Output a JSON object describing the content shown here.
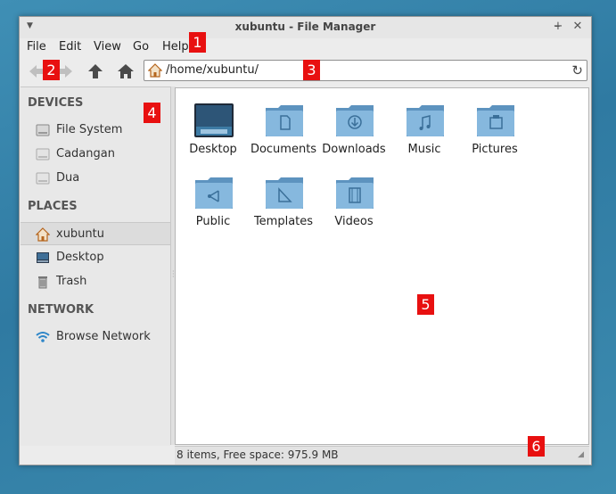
{
  "window": {
    "title": "xubuntu - File Manager",
    "controls": {
      "minimize": "–",
      "maximize": "+",
      "close": "✕"
    }
  },
  "menubar": [
    "File",
    "Edit",
    "View",
    "Go",
    "Help"
  ],
  "location": {
    "path": "/home/xubuntu/"
  },
  "sidebar": {
    "devices_heading": "DEVICES",
    "devices": [
      "File System",
      "Cadangan",
      "Dua"
    ],
    "places_heading": "PLACES",
    "places": [
      "xubuntu",
      "Desktop",
      "Trash"
    ],
    "network_heading": "NETWORK",
    "network": [
      "Browse Network"
    ],
    "selected": "xubuntu"
  },
  "files": [
    {
      "name": "Desktop",
      "icon": "desktop-folder-icon"
    },
    {
      "name": "Documents",
      "icon": "documents-folder-icon"
    },
    {
      "name": "Downloads",
      "icon": "downloads-folder-icon"
    },
    {
      "name": "Music",
      "icon": "music-folder-icon"
    },
    {
      "name": "Pictures",
      "icon": "pictures-folder-icon"
    },
    {
      "name": "Public",
      "icon": "public-folder-icon"
    },
    {
      "name": "Templates",
      "icon": "templates-folder-icon"
    },
    {
      "name": "Videos",
      "icon": "videos-folder-icon"
    }
  ],
  "status": {
    "text": "8 items, Free space: 975.9 MB"
  },
  "badges": [
    "1",
    "2",
    "3",
    "4",
    "5",
    "6"
  ],
  "colors": {
    "badge": "#e81010",
    "folder": "#7fb2d9",
    "desktop_bg": "#3f8fb5"
  }
}
